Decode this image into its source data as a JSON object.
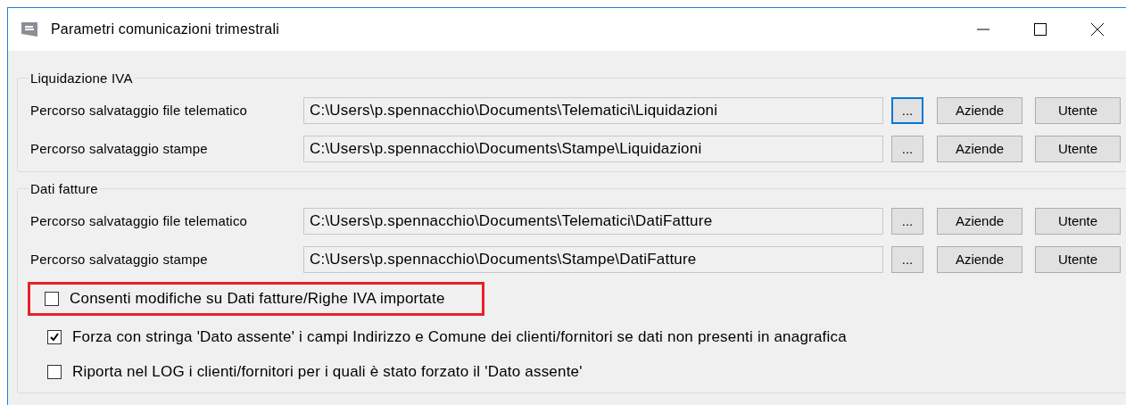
{
  "window": {
    "title": "Parametri comunicazioni trimestrali"
  },
  "groups": [
    {
      "title": "Liquidazione IVA",
      "rows": [
        {
          "label": "Percorso salvataggio file telematico",
          "value": "C:\\Users\\p.spennacchio\\Documents\\Telematici\\Liquidazioni",
          "buttons": [
            {
              "label": "...",
              "focused": true
            },
            {
              "label": "Aziende",
              "focused": false
            },
            {
              "label": "Utente",
              "focused": false
            }
          ]
        },
        {
          "label": "Percorso salvataggio stampe",
          "value": "C:\\Users\\p.spennacchio\\Documents\\Stampe\\Liquidazioni",
          "buttons": [
            {
              "label": "...",
              "focused": false
            },
            {
              "label": "Aziende",
              "focused": false
            },
            {
              "label": "Utente",
              "focused": false
            }
          ]
        }
      ]
    },
    {
      "title": "Dati fatture",
      "rows": [
        {
          "label": "Percorso salvataggio file telematico",
          "value": "C:\\Users\\p.spennacchio\\Documents\\Telematici\\DatiFatture",
          "buttons": [
            {
              "label": "...",
              "focused": false
            },
            {
              "label": "Aziende",
              "focused": false
            },
            {
              "label": "Utente",
              "focused": false
            }
          ]
        },
        {
          "label": "Percorso salvataggio stampe",
          "value": "C:\\Users\\p.spennacchio\\Documents\\Stampe\\DatiFatture",
          "buttons": [
            {
              "label": "...",
              "focused": false
            },
            {
              "label": "Aziende",
              "focused": false
            },
            {
              "label": "Utente",
              "focused": false
            }
          ]
        }
      ],
      "options": [
        {
          "label": "Consenti modifiche su Dati fatture/Righe IVA importate",
          "checked": false,
          "highlighted": true
        },
        {
          "label": "Forza con stringa 'Dato assente' i campi Indirizzo e Comune dei clienti/fornitori se dati non presenti in anagrafica",
          "checked": true,
          "highlighted": false
        },
        {
          "label": "Riporta nel LOG i clienti/fornitori per i quali è stato forzato il 'Dato assente'",
          "checked": false,
          "highlighted": false
        }
      ]
    }
  ]
}
